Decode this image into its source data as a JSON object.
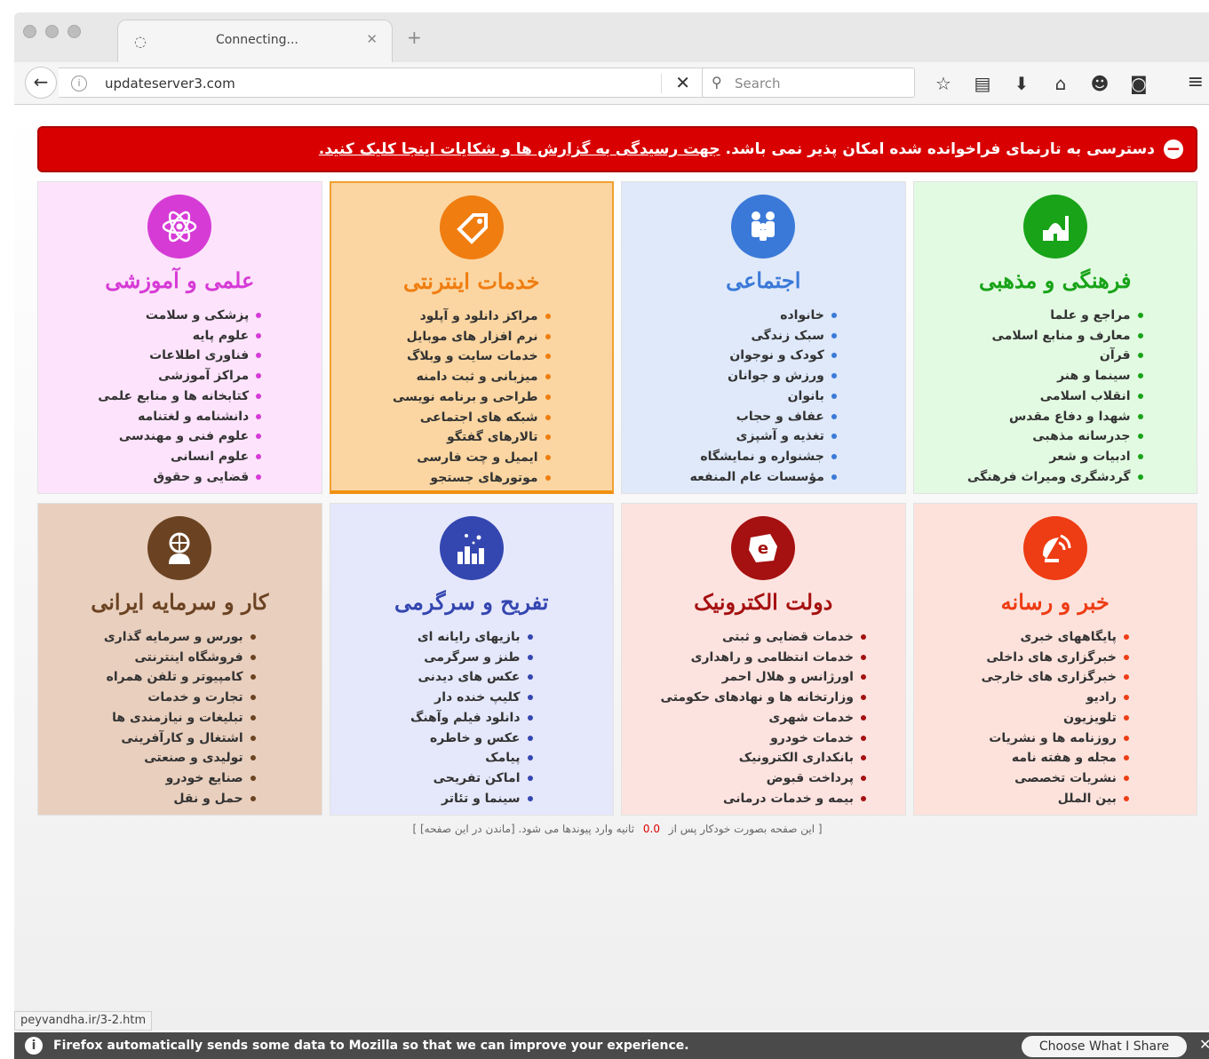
{
  "browser": {
    "tab_title": "Connecting...",
    "url": "updateserver3.com",
    "search_placeholder": "Search"
  },
  "alert": {
    "text": "دسترسی به تارنمای فراخوانده شده امکان پذیر نمی باشد.",
    "link": "جهت رسیدگی به گزارش ها و شکایات اینجا کلیک کنید."
  },
  "categories": [
    {
      "title": "فرهنگی و مذهبی",
      "color": "#18a318",
      "bg": "#e2fae2",
      "icon": "mosque-icon",
      "items": [
        "مراجع و علما",
        "معارف و منابع اسلامی",
        "قرآن",
        "سینما و هنر",
        "انقلاب اسلامی",
        "شهدا و دفاع مقدس",
        "جدرسانه مذهبی",
        "ادبیات و شعر",
        "گردشگری ومیراث فرهنگی"
      ]
    },
    {
      "title": "اجتماعی",
      "color": "#3a79d8",
      "bg": "#dfe9fa",
      "icon": "family-icon",
      "items": [
        "خانواده",
        "سبک زندگی",
        "کودک و نوجوان",
        "ورزش و جوانان",
        "بانوان",
        "عفاف و حجاب",
        "تغذیه و آشپزی",
        "جشنواره و نمایشگاه",
        "مؤسسات عام المنفعه"
      ]
    },
    {
      "title": "خدمات اینترنتی",
      "color": "#f07d10",
      "bg": "#fbd6a2",
      "icon": "price-tag-icon",
      "items": [
        "مراکز دانلود و آپلود",
        "نرم افزار های موبایل",
        "خدمات سایت و وبلاگ",
        "میزبانی و ثبت دامنه",
        "طراحی و برنامه نویسی",
        "شبکه های اجتماعی",
        "تالارهای گفتگو",
        "ایمیل و چت فارسی",
        "موتورهای جستجو"
      ]
    },
    {
      "title": "علمی و آموزشی",
      "color": "#d63bd6",
      "bg": "#fde3fb",
      "icon": "atom-icon",
      "items": [
        "پزشکی و سلامت",
        "علوم پایه",
        "فناوری اطلاعات",
        "مراکز آموزشی",
        "کتابخانه ها و منابع علمی",
        "دانشنامه و لغتنامه",
        "علوم فنی و مهندسی",
        "علوم انسانی",
        "قضایی و حقوق"
      ]
    },
    {
      "title": "خبر و رسانه",
      "color": "#ee3c14",
      "bg": "#fde2dc",
      "icon": "satellite-dish-icon",
      "items": [
        "پایگاههای خبری",
        "خبرگزاری های داخلی",
        "خبرگزاری های خارجی",
        "رادیو",
        "تلویزیون",
        "روزنامه ها و نشریات",
        "مجله و هفته نامه",
        "نشریات تخصصی",
        "بین الملل"
      ]
    },
    {
      "title": "دولت الکترونیک",
      "color": "#a51010",
      "bg": "#fde3e0",
      "icon": "iran-map-e-icon",
      "items": [
        "خدمات قضایی و ثبتی",
        "خدمات انتظامی و راهداری",
        "اورژانس و هلال احمر",
        "وزارتخانه ها و نهادهای حکومتی",
        "خدمات شهری",
        "خدمات خودرو",
        "بانکداری الکترونیک",
        "پرداخت قبوض",
        "بیمه و خدمات درمانی"
      ]
    },
    {
      "title": "تفریح و سرگرمی",
      "color": "#3446b0",
      "bg": "#e5e8fb",
      "icon": "city-fireworks-icon",
      "items": [
        "بازیهای رایانه ای",
        "طنز و سرگرمی",
        "عکس های دیدنی",
        "کلیپ خنده دار",
        "دانلود فیلم وآهنگ",
        "عکس و خاطره",
        "پیامک",
        "اماکن تفریحی",
        "سینما و تئاتر"
      ]
    },
    {
      "title": "کار و سرمایه ایرانی",
      "color": "#6b4322",
      "bg": "#e9cfbe",
      "icon": "globe-worker-icon",
      "items": [
        "بورس و سرمایه گذاری",
        "فروشگاه اینترنتی",
        "کامپیوتر و تلفن همراه",
        "تجارت و خدمات",
        "تبلیغات و نیازمندی ها",
        "اشتغال و کارآفرینی",
        "تولیدی و صنعتی",
        "صنایع خودرو",
        "حمل و نقل"
      ]
    }
  ],
  "countdown": {
    "prefix": "[ این صفحه بصورت خودکار پس از",
    "seconds": "0.0",
    "suffix": "ثانیه وارد پیوندها می شود. [ماندن در این صفحه] ]"
  },
  "status_link": "peyvandha.ir/3-2.htm",
  "notification": {
    "text": "Firefox automatically sends some data to Mozilla so that we can improve your experience.",
    "button": "Choose What I Share"
  }
}
